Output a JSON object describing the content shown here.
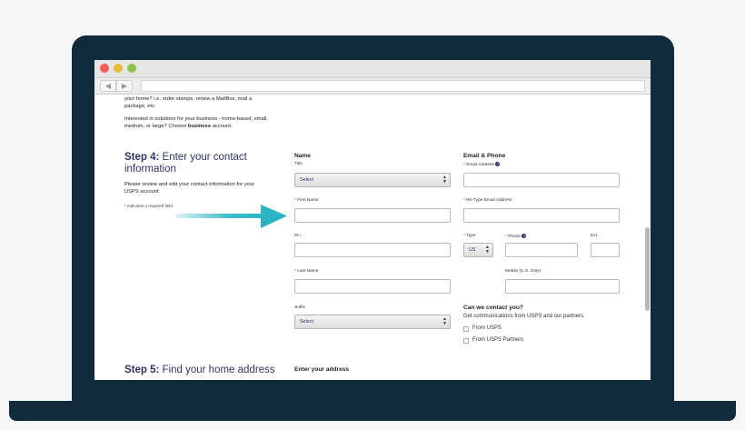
{
  "intro": {
    "line1": "your home? i.e. order stamps, renew a MailBox, mail a",
    "line2": "package, etc.",
    "line3": "Interested in solutions for your business - home-based, small,",
    "line4_before": "medium, or large? Choose ",
    "line4_bold": "business",
    "line4_after": " account."
  },
  "step4": {
    "prefix": "Step 4:",
    "title_line1": " Enter your contact",
    "title_line2": "information",
    "desc_line1": "Please review and edit your contact information for your",
    "desc_line2": "USPS account",
    "required_mark": "*",
    "required_note": " indicates a required field"
  },
  "name_section": {
    "heading": "Name",
    "title_label": "Title",
    "title_value": "Select",
    "first_name_label": "First Name",
    "mi_label": "M.I.",
    "last_name_label": "Last Name",
    "suffix_label": "Suffix",
    "suffix_value": "Select"
  },
  "email_section": {
    "heading": "Email & Phone",
    "email_label": "Email Address",
    "retype_label": "Re-Type Email Address",
    "type_label": "Type",
    "type_value": "US",
    "phone_label": "Phone",
    "ext_label": "Ext.",
    "mobile_label": "Mobile (U.S. Only)"
  },
  "contact_section": {
    "heading": "Can we contact you?",
    "subtext": "Get communications from USPS and our partners.",
    "option1": "From USPS",
    "option2": "From USPS Partners"
  },
  "step5": {
    "prefix": "Step 5:",
    "title": " Find your home address",
    "address_heading": "Enter your address"
  },
  "colors": {
    "laptop": "#0f2b3c",
    "arrow": "#2bb5c4",
    "step_title": "#333366",
    "required": "#c8202e"
  }
}
